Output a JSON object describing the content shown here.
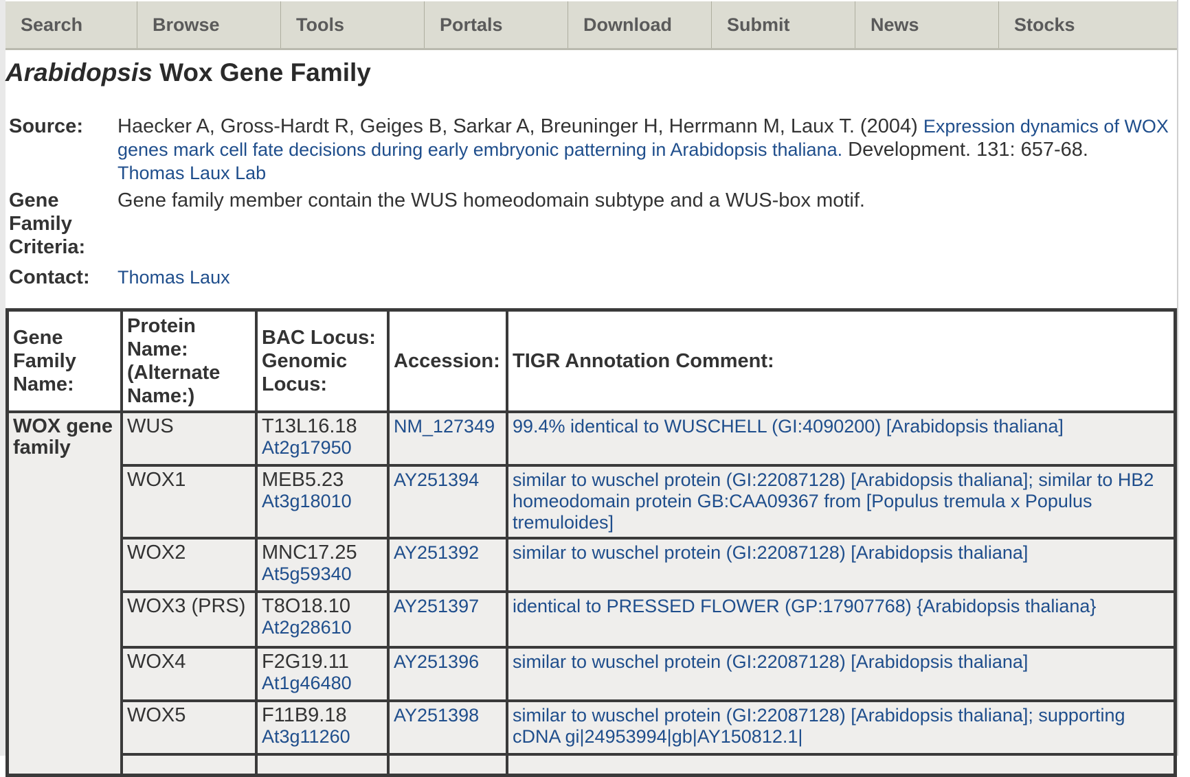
{
  "nav": [
    {
      "label": "Search"
    },
    {
      "label": "Browse"
    },
    {
      "label": "Tools"
    },
    {
      "label": "Portals"
    },
    {
      "label": "Download"
    },
    {
      "label": "Submit"
    },
    {
      "label": "News"
    },
    {
      "label": "Stocks"
    }
  ],
  "title": {
    "italic": "Arabidopsis",
    "rest": " Wox Gene Family"
  },
  "source": {
    "label": "Source:",
    "authors": "Haecker A, Gross-Hardt R, Geiges B, Sarkar A, Breuninger H, Herrmann M, Laux T. (2004) ",
    "paper_link": "Expression dynamics of WOX genes mark cell fate decisions during early embryonic patterning in Arabidopsis thaliana.",
    "journal": " Development. 131: 657-68.",
    "lab_link": "Thomas Laux Lab"
  },
  "criteria": {
    "label": "Gene Family Criteria:",
    "text": "Gene family member contain the WUS homeodomain subtype and a WUS-box motif."
  },
  "contact": {
    "label": "Contact:",
    "link": "Thomas Laux"
  },
  "table": {
    "headers": {
      "family": "Gene Family Name:",
      "protein": "Protein Name: (Alternate Name:)",
      "locus": "BAC Locus: Genomic Locus:",
      "accession": "Accession:",
      "comment": "TIGR Annotation Comment:"
    },
    "family_name": "WOX gene family",
    "rows": [
      {
        "protein": "WUS",
        "bac": "T13L16.18",
        "genomic": "At2g17950",
        "accession": "NM_127349",
        "comment": "99.4% identical to WUSCHELL (GI:4090200) [Arabidopsis thaliana]"
      },
      {
        "protein": "WOX1",
        "bac": "MEB5.23",
        "genomic": "At3g18010",
        "accession": "AY251394",
        "comment": "similar to wuschel protein (GI:22087128) [Arabidopsis thaliana]; similar to HB2 homeodomain protein GB:CAA09367 from [Populus tremula x Populus tremuloides]"
      },
      {
        "protein": "WOX2",
        "bac": "MNC17.25",
        "genomic": "At5g59340",
        "accession": "AY251392",
        "comment": "similar to wuschel protein (GI:22087128) [Arabidopsis thaliana]"
      },
      {
        "protein": "WOX3 (PRS)",
        "bac": "T8O18.10",
        "genomic": "At2g28610",
        "accession": "AY251397",
        "comment": "identical to PRESSED FLOWER (GP:17907768) {Arabidopsis thaliana}"
      },
      {
        "protein": "WOX4",
        "bac": "F2G19.11",
        "genomic": "At1g46480",
        "accession": "AY251396",
        "comment": "similar to wuschel protein (GI:22087128) [Arabidopsis thaliana]"
      },
      {
        "protein": "WOX5",
        "bac": "F11B9.18",
        "genomic": "At3g11260",
        "accession": "AY251398",
        "comment": "similar to wuschel protein (GI:22087128) [Arabidopsis thaliana]; supporting cDNA gi|24953994|gb|AY150812.1|"
      }
    ]
  }
}
